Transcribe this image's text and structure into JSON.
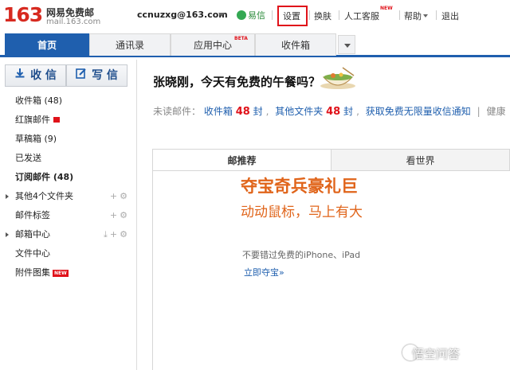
{
  "header": {
    "logo_num": "163",
    "logo_name": "网易免费邮",
    "logo_url": "mail.163.com",
    "user_email": "ccnuzxg@163.com",
    "yixin": "易信",
    "settings": "设置",
    "skin": "换肤",
    "support": "人工客服",
    "support_badge": "NEW",
    "help": "帮助",
    "logout": "退出"
  },
  "tabs": [
    {
      "label": "首页"
    },
    {
      "label": "通讯录"
    },
    {
      "label": "应用中心",
      "badge": "BETA"
    },
    {
      "label": "收件箱"
    }
  ],
  "sidebar": {
    "receive": "收 信",
    "compose": "写 信",
    "folders": [
      {
        "label": "收件箱 (48)"
      },
      {
        "label": "红旗邮件"
      },
      {
        "label": "草稿箱 (9)"
      },
      {
        "label": "已发送"
      },
      {
        "label": "订阅邮件 (48)"
      },
      {
        "label": "其他4个文件夹"
      },
      {
        "label": "邮件标签"
      },
      {
        "label": "邮箱中心"
      },
      {
        "label": "文件中心"
      },
      {
        "label": "附件图集",
        "badge": "NEW"
      }
    ]
  },
  "main": {
    "greeting": "张晓刚，今天有免费的午餐吗？",
    "unread_label": "未读邮件：",
    "inbox_label": "收件箱",
    "inbox_count": "48",
    "unit": "封",
    "other_label": "其他文件夹",
    "other_count": "48",
    "notify_link": "获取免费无限量收信通知",
    "health": "健康",
    "content_tabs": [
      "邮推荐",
      "看世界"
    ],
    "promo_title": "夺宝奇兵豪礼巨",
    "promo_sub": "动动鼠标，马上有大",
    "promo_small": "不要错过免费的iPhone、iPad",
    "promo_link": "立即夺宝»"
  },
  "watermark": "悟空问答",
  "colors": {
    "brand_red": "#d72a20",
    "tab_blue": "#1f5fae",
    "promo_orange": "#e0641a"
  }
}
